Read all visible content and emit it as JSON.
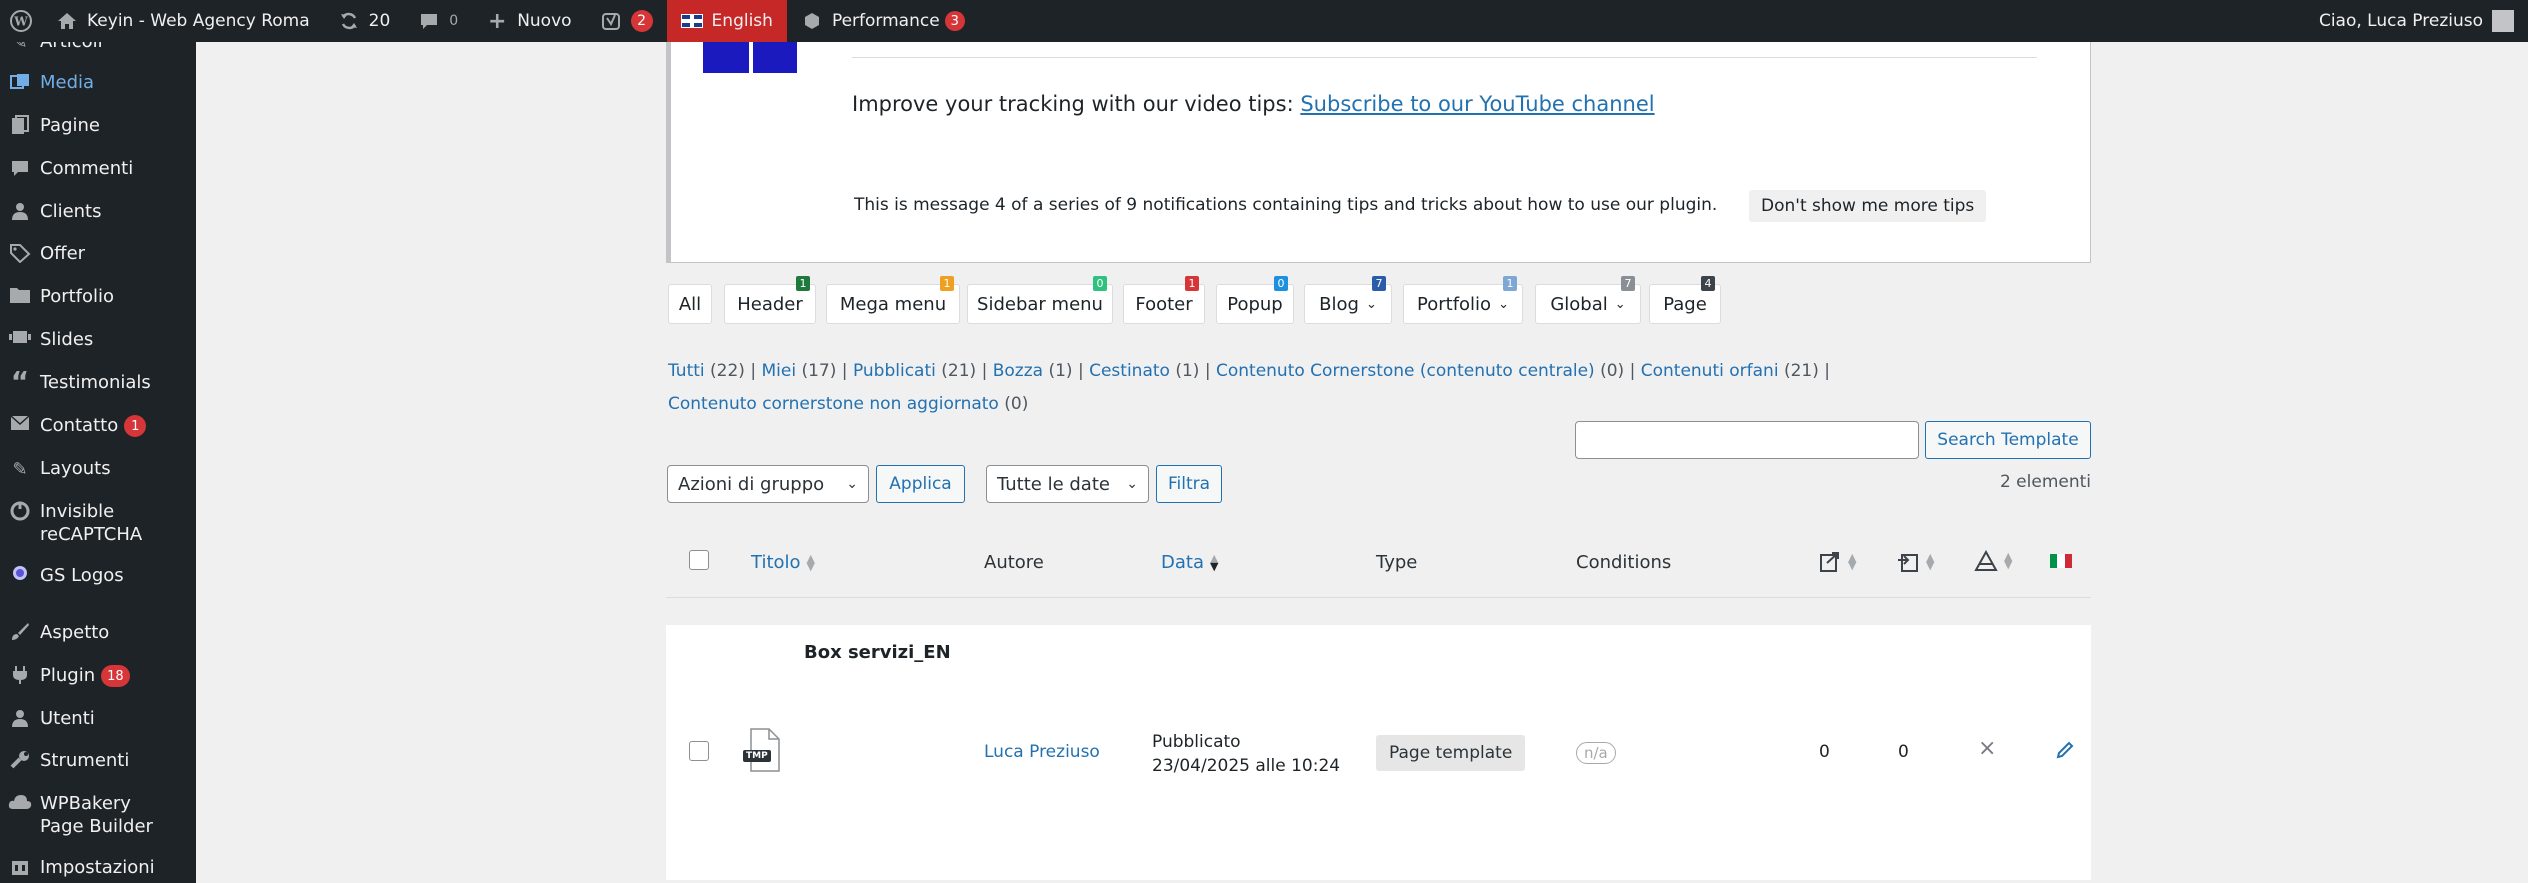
{
  "adminbar": {
    "site_name": "Keyin - Web Agency Roma",
    "updates": "20",
    "comments": "0",
    "new_label": "Nuovo",
    "yoast_count": "2",
    "language": "English",
    "performance_label": "Performance",
    "performance_count": "3",
    "greeting": "Ciao, Luca Preziuso"
  },
  "sidebar": {
    "items": [
      {
        "label": "Articoli",
        "icon": "pin-icon"
      },
      {
        "label": "Media",
        "icon": "media-icon"
      },
      {
        "label": "Pagine",
        "icon": "page-icon"
      },
      {
        "label": "Commenti",
        "icon": "comment-icon"
      },
      {
        "label": "Clients",
        "icon": "user-icon"
      },
      {
        "label": "Offer",
        "icon": "tag-icon"
      },
      {
        "label": "Portfolio",
        "icon": "folder-icon"
      },
      {
        "label": "Slides",
        "icon": "slides-icon"
      },
      {
        "label": "Testimonials",
        "icon": "quote-icon"
      },
      {
        "label": "Contatto",
        "icon": "mail-icon",
        "badge": "1"
      },
      {
        "label": "Layouts",
        "icon": "pencil-icon"
      },
      {
        "label": "Invisible reCAPTCHA",
        "icon": "recaptcha-icon"
      },
      {
        "label": "GS Logos",
        "icon": "logos-icon"
      },
      {
        "label": "Aspetto",
        "icon": "brush-icon"
      },
      {
        "label": "Plugin",
        "icon": "plugin-icon",
        "badge": "18"
      },
      {
        "label": "Utenti",
        "icon": "users-icon"
      },
      {
        "label": "Strumenti",
        "icon": "wrench-icon"
      },
      {
        "label": "WPBakery Page Builder",
        "icon": "cloud-icon"
      },
      {
        "label": "Impostazioni",
        "icon": "settings-icon"
      }
    ]
  },
  "notice": {
    "text": "Improve your tracking with our video tips:",
    "link": "Subscribe to our YouTube channel",
    "message": "This is message 4 of a series of 9 notifications containing tips and tricks about how to use our plugin.",
    "dismiss": "Don't show me more tips"
  },
  "tabs": [
    {
      "label": "All",
      "count": ""
    },
    {
      "label": "Header",
      "count": "1",
      "color": "#1e7a3c"
    },
    {
      "label": "Mega menu",
      "count": "1",
      "color": "#f0a020"
    },
    {
      "label": "Sidebar menu",
      "count": "0",
      "color": "#2ec27e"
    },
    {
      "label": "Footer",
      "count": "1",
      "color": "#d63638"
    },
    {
      "label": "Popup",
      "count": "0",
      "color": "#1e90e0"
    },
    {
      "label": "Blog",
      "count": "7",
      "color": "#2a5caa"
    },
    {
      "label": "Portfolio",
      "count": "1",
      "color": "#7fa7d6"
    },
    {
      "label": "Global",
      "count": "7",
      "color": "#8a8f96"
    },
    {
      "label": "Page",
      "count": "4",
      "color": "#3c434a"
    }
  ],
  "views": {
    "tutti": "Tutti",
    "tutti_n": "(22)",
    "miei": "Miei",
    "miei_n": "(17)",
    "pubblicati": "Pubblicati",
    "pubblicati_n": "(21)",
    "bozza": "Bozza",
    "bozza_n": "(1)",
    "cestinato": "Cestinato",
    "cestinato_n": "(1)",
    "cornerstone": "Contenuto Cornerstone (contenuto centrale)",
    "cornerstone_n": "(0)",
    "orfani": "Contenuti orfani",
    "orfani_n": "(21)",
    "non_aggiornato": "Contenuto cornerstone non aggiornato",
    "non_aggiornato_n": "(0)"
  },
  "controls": {
    "search_button": "Search Template",
    "bulk_actions": "Azioni di gruppo",
    "apply": "Applica",
    "dates": "Tutte le date",
    "filter": "Filtra",
    "count": "2 elementi"
  },
  "table": {
    "headers": {
      "title": "Titolo",
      "author": "Autore",
      "date": "Data",
      "type": "Type",
      "conditions": "Conditions"
    },
    "row": {
      "title": "Box servizi_EN",
      "file_tag": "TMP",
      "author": "Luca Preziuso",
      "status": "Pubblicato",
      "date": "23/04/2025 alle 10:24",
      "type": "Page template",
      "conditions": "n/a",
      "links_out": "0",
      "links_in": "0"
    }
  }
}
